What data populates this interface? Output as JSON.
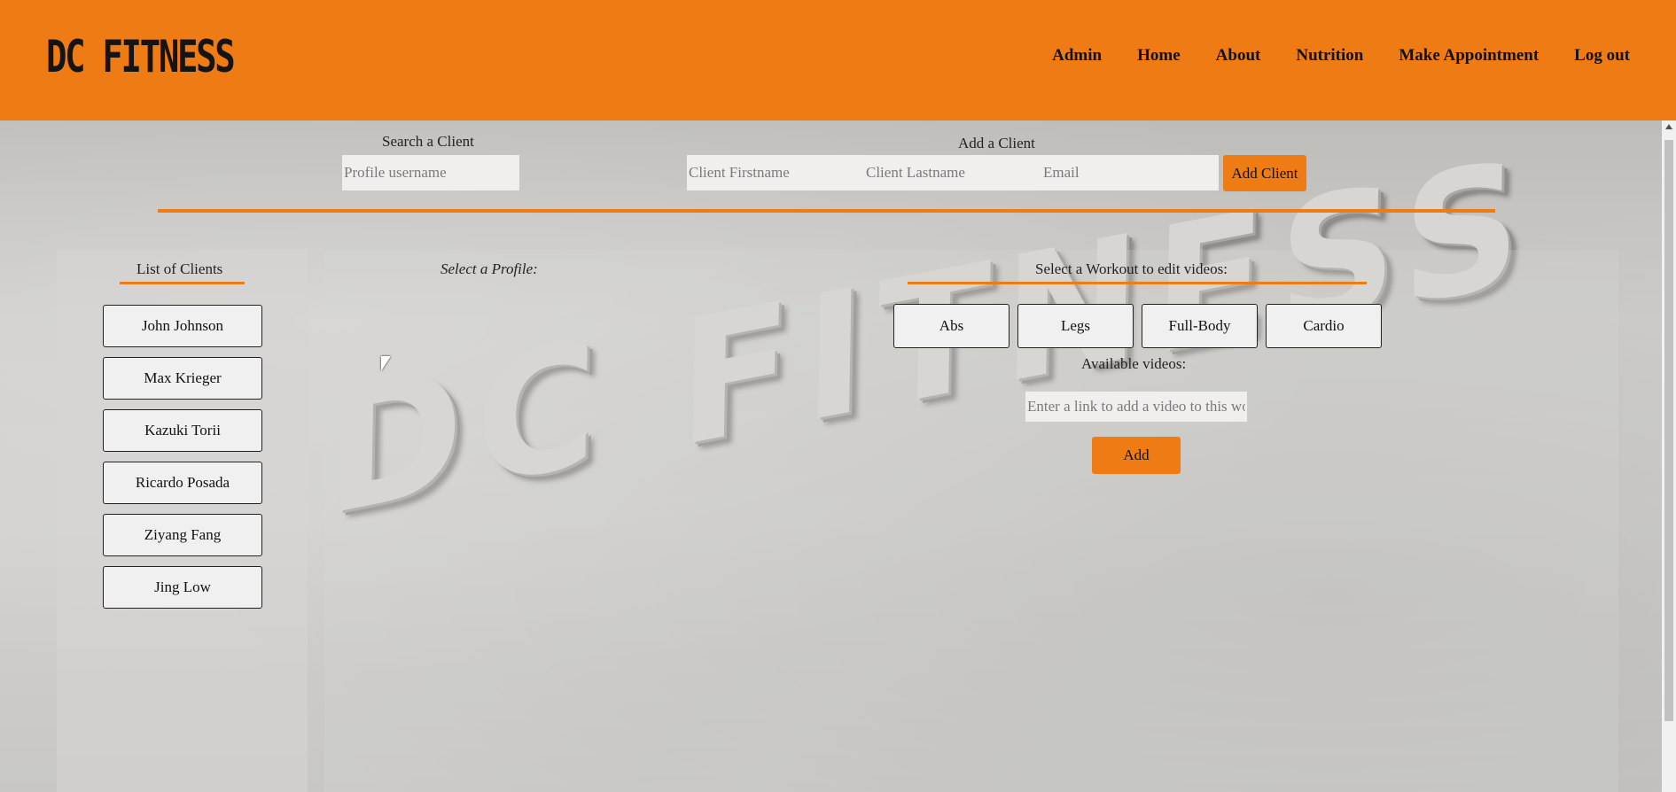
{
  "brand": {
    "logo_text": "DC FITNESS",
    "watermark_text": "DC FITNESS"
  },
  "nav": {
    "items": [
      "Admin",
      "Home",
      "About",
      "Nutrition",
      "Make Appointment",
      "Log out"
    ]
  },
  "search": {
    "label": "Search a Client",
    "placeholder": "Profile username"
  },
  "add_client": {
    "label": "Add a Client",
    "firstname_placeholder": "Client Firstname",
    "lastname_placeholder": "Client Lastname",
    "email_placeholder": "Email",
    "button_label": "Add Client"
  },
  "clients": {
    "heading": "List of Clients",
    "items": [
      "John Johnson",
      "Max Krieger",
      "Kazuki Torii",
      "Ricardo Posada",
      "Ziyang Fang",
      "Jing Low"
    ]
  },
  "profile": {
    "heading": "Select a Profile:"
  },
  "workouts": {
    "heading": "Select a Workout to edit videos:",
    "items": [
      "Abs",
      "Legs",
      "Full-Body",
      "Cardio"
    ],
    "videos_label": "Available videos:",
    "link_placeholder": "Enter a link to add a video to this workout",
    "add_label": "Add"
  },
  "colors": {
    "accent": "#ee7b13",
    "text": "#111111"
  }
}
